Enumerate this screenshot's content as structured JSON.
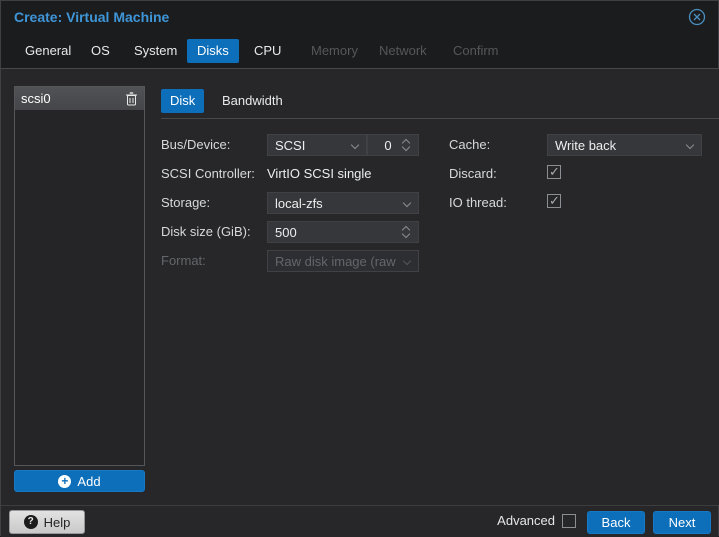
{
  "window": {
    "title": "Create: Virtual Machine"
  },
  "colors": {
    "accent": "#0d6eba",
    "title_blue": "#3e96d8",
    "page_bg": "#272729",
    "header_bg": "#1b1c1e",
    "field_bg": "#36373a"
  },
  "tabs": [
    {
      "label": "General",
      "state": "normal"
    },
    {
      "label": "OS",
      "state": "normal"
    },
    {
      "label": "System",
      "state": "normal"
    },
    {
      "label": "Disks",
      "state": "active"
    },
    {
      "label": "CPU",
      "state": "normal"
    },
    {
      "label": "Memory",
      "state": "disabled"
    },
    {
      "label": "Network",
      "state": "disabled"
    },
    {
      "label": "Confirm",
      "state": "disabled"
    }
  ],
  "disk_list": {
    "items": [
      {
        "label": "scsi0",
        "selected": true
      }
    ],
    "add_label": "Add",
    "add_icon": "+"
  },
  "subtabs": [
    {
      "label": "Disk",
      "active": true
    },
    {
      "label": "Bandwidth",
      "active": false
    }
  ],
  "form": {
    "left": [
      {
        "label": "Bus/Device:",
        "type": "combo-number",
        "combo_value": "SCSI",
        "number_value": "0"
      },
      {
        "label": "SCSI Controller:",
        "type": "text",
        "value": "VirtIO SCSI single"
      },
      {
        "label": "Storage:",
        "type": "combo",
        "value": "local-zfs"
      },
      {
        "label": "Disk size (GiB):",
        "type": "number",
        "value": "500"
      },
      {
        "label": "Format:",
        "type": "combo",
        "value": "Raw disk image (raw",
        "disabled": true
      }
    ],
    "right": [
      {
        "label": "Cache:",
        "type": "combo",
        "value": "Write back"
      },
      {
        "label": "Discard:",
        "type": "checkbox",
        "checked": true
      },
      {
        "label": "IO thread:",
        "type": "checkbox",
        "checked": true
      }
    ]
  },
  "footer": {
    "help_label": "Help",
    "help_icon": "?",
    "advanced_label": "Advanced",
    "advanced_checked": false,
    "back_label": "Back",
    "next_label": "Next"
  }
}
